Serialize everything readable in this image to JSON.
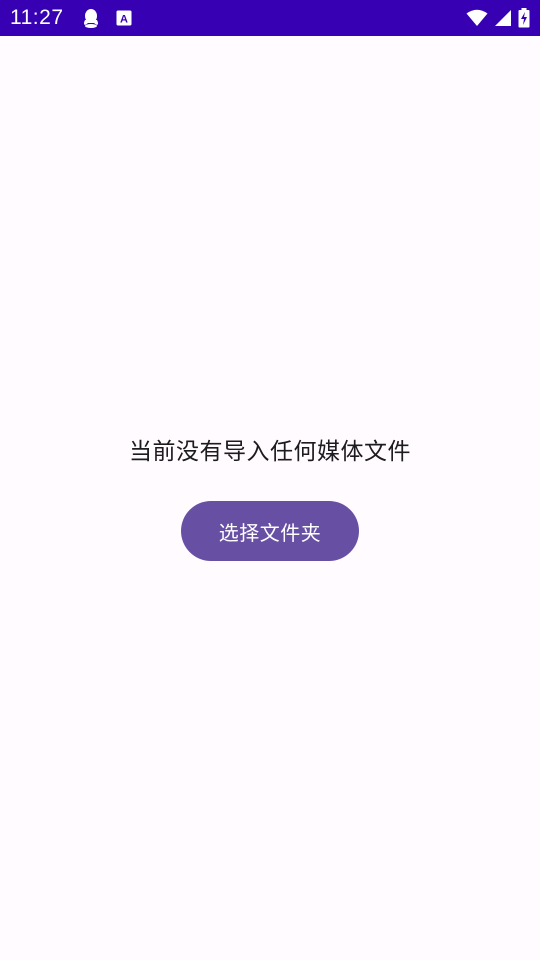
{
  "status_bar": {
    "time": "11:27",
    "left_icons": [
      "qq-icon",
      "keyboard-a-icon"
    ],
    "right_icons": [
      "wifi-icon",
      "signal-icon",
      "battery-charging-icon"
    ],
    "keyboard_icon_letter": "A",
    "background_color": "#3700b3"
  },
  "main": {
    "empty_message": "当前没有导入任何媒体文件",
    "select_folder_label": "选择文件夹",
    "button_color": "#6750a4",
    "background_color": "#fffbfe"
  }
}
